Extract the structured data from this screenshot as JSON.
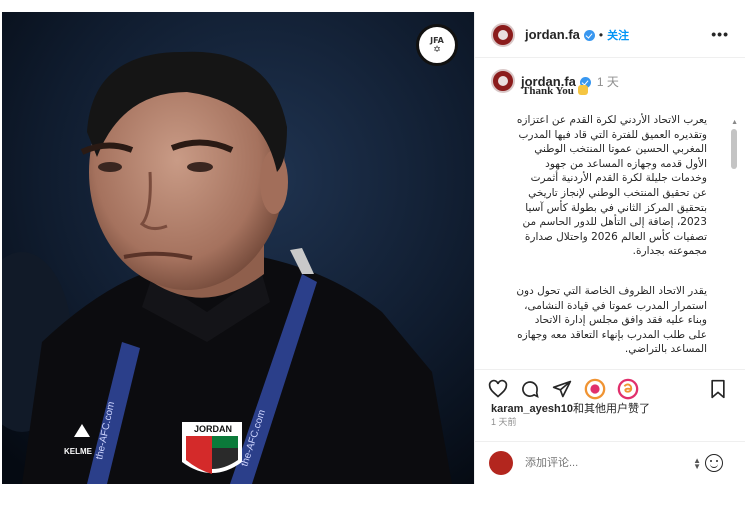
{
  "post": {
    "badge_text": "JFA",
    "photo_text": [
      "KELME",
      "the-AFC.com",
      "the-AFC.com",
      "JORDAN"
    ]
  },
  "header": {
    "username": "jordan.fa",
    "follow_label": "关注",
    "more_label": "•••"
  },
  "caption": {
    "username": "jordan.fa",
    "time": "1 天",
    "title": "Thank You",
    "paragraph1": "يعرب الاتحاد الأردني لكرة القدم عن اعتزازه وتقديره العميق للفترة التي قاد فيها المدرب المغربي الحسين عموتا المنتخب الوطني الأول قدمه وجهازه المساعد من جهود وخدمات جليلة لكرة القدم الأردنية أثمرت عن تحقيق المنتخب الوطني لإنجاز تاريخي بتحقيق المركز الثاني في بطولة كأس آسيا 2023، إضافة إلى التأهل للدور الحاسم من تصفيات كأس العالم 2026 واحتلال صدارة مجموعته بجدارة.",
    "paragraph2": "يقدر الاتحاد الظروف الخاصة التي تحول دون استمرار المدرب عموتا في قيادة النشامى، وبناء عليه فقد وافق مجلس إدارة الاتحاد على طلب المدرب بإنهاء التعاقد معه وجهازه المساعد بالتراضي."
  },
  "likes": {
    "user": "karam_ayesh10",
    "suffix": "和其他用户赞了"
  },
  "time_ago": "1 天前",
  "comment": {
    "placeholder": "添加评论..."
  },
  "colors": {
    "accent": "#0095f6",
    "verified": "#3897f0",
    "brand": "#8b1c1c"
  },
  "icons": [
    "heart-icon",
    "comment-icon",
    "share-icon",
    "reel-icon",
    "threads-icon",
    "save-icon",
    "emoji-icon"
  ]
}
